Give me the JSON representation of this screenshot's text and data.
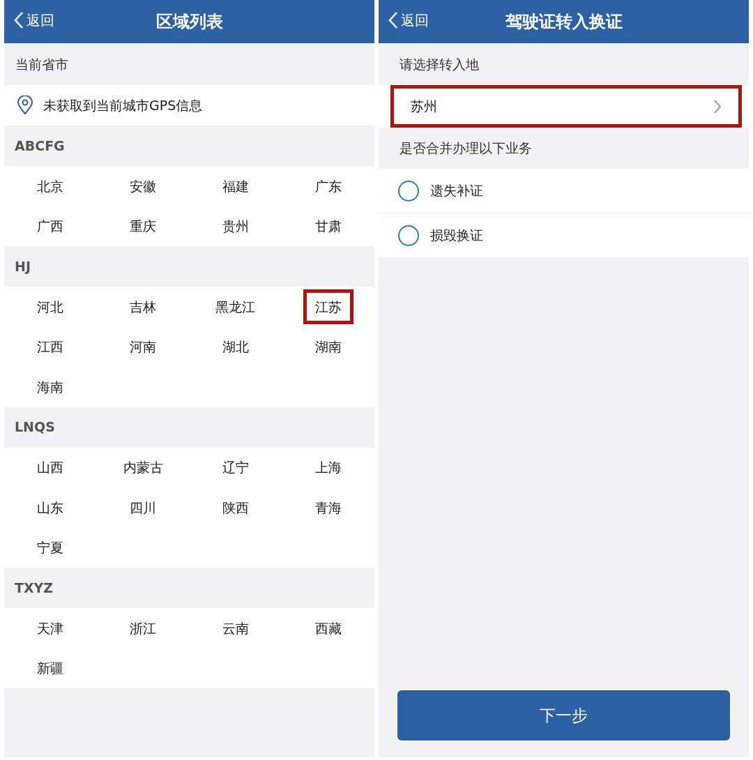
{
  "region_list": {
    "back": "返回",
    "title": "区域列表",
    "current_label": "当前省市",
    "gps_text": "未获取到当前城市GPS信息",
    "groups": [
      {
        "letters": "ABCFG",
        "items": [
          {
            "name": "北京",
            "highlighted": false
          },
          {
            "name": "安徽",
            "highlighted": false
          },
          {
            "name": "福建",
            "highlighted": false
          },
          {
            "name": "广东",
            "highlighted": false
          },
          {
            "name": "广西",
            "highlighted": false
          },
          {
            "name": "重庆",
            "highlighted": false
          },
          {
            "name": "贵州",
            "highlighted": false
          },
          {
            "name": "甘肃",
            "highlighted": false
          }
        ]
      },
      {
        "letters": "HJ",
        "items": [
          {
            "name": "河北",
            "highlighted": false
          },
          {
            "name": "吉林",
            "highlighted": false
          },
          {
            "name": "黑龙江",
            "highlighted": false
          },
          {
            "name": "江苏",
            "highlighted": true
          },
          {
            "name": "江西",
            "highlighted": false
          },
          {
            "name": "河南",
            "highlighted": false
          },
          {
            "name": "湖北",
            "highlighted": false
          },
          {
            "name": "湖南",
            "highlighted": false
          },
          {
            "name": "海南",
            "highlighted": false
          }
        ]
      },
      {
        "letters": "LNQS",
        "items": [
          {
            "name": "山西",
            "highlighted": false
          },
          {
            "name": "内蒙古",
            "highlighted": false
          },
          {
            "name": "辽宁",
            "highlighted": false
          },
          {
            "name": "上海",
            "highlighted": false
          },
          {
            "name": "山东",
            "highlighted": false
          },
          {
            "name": "四川",
            "highlighted": false
          },
          {
            "name": "陕西",
            "highlighted": false
          },
          {
            "name": "青海",
            "highlighted": false
          },
          {
            "name": "宁夏",
            "highlighted": false
          }
        ]
      },
      {
        "letters": "TXYZ",
        "items": [
          {
            "name": "天津",
            "highlighted": false
          },
          {
            "name": "浙江",
            "highlighted": false
          },
          {
            "name": "云南",
            "highlighted": false
          },
          {
            "name": "西藏",
            "highlighted": false
          },
          {
            "name": "新疆",
            "highlighted": false
          }
        ]
      }
    ]
  },
  "transfer": {
    "back": "返回",
    "title": "驾驶证转入换证",
    "destination_label": "请选择转入地",
    "destination": {
      "value": "苏州",
      "highlighted": true
    },
    "options_label": "是否合并办理以下业务",
    "options": [
      {
        "label": "遗失补证",
        "checked": false
      },
      {
        "label": "损毁换证",
        "checked": false
      }
    ],
    "next_button": "下一步"
  }
}
